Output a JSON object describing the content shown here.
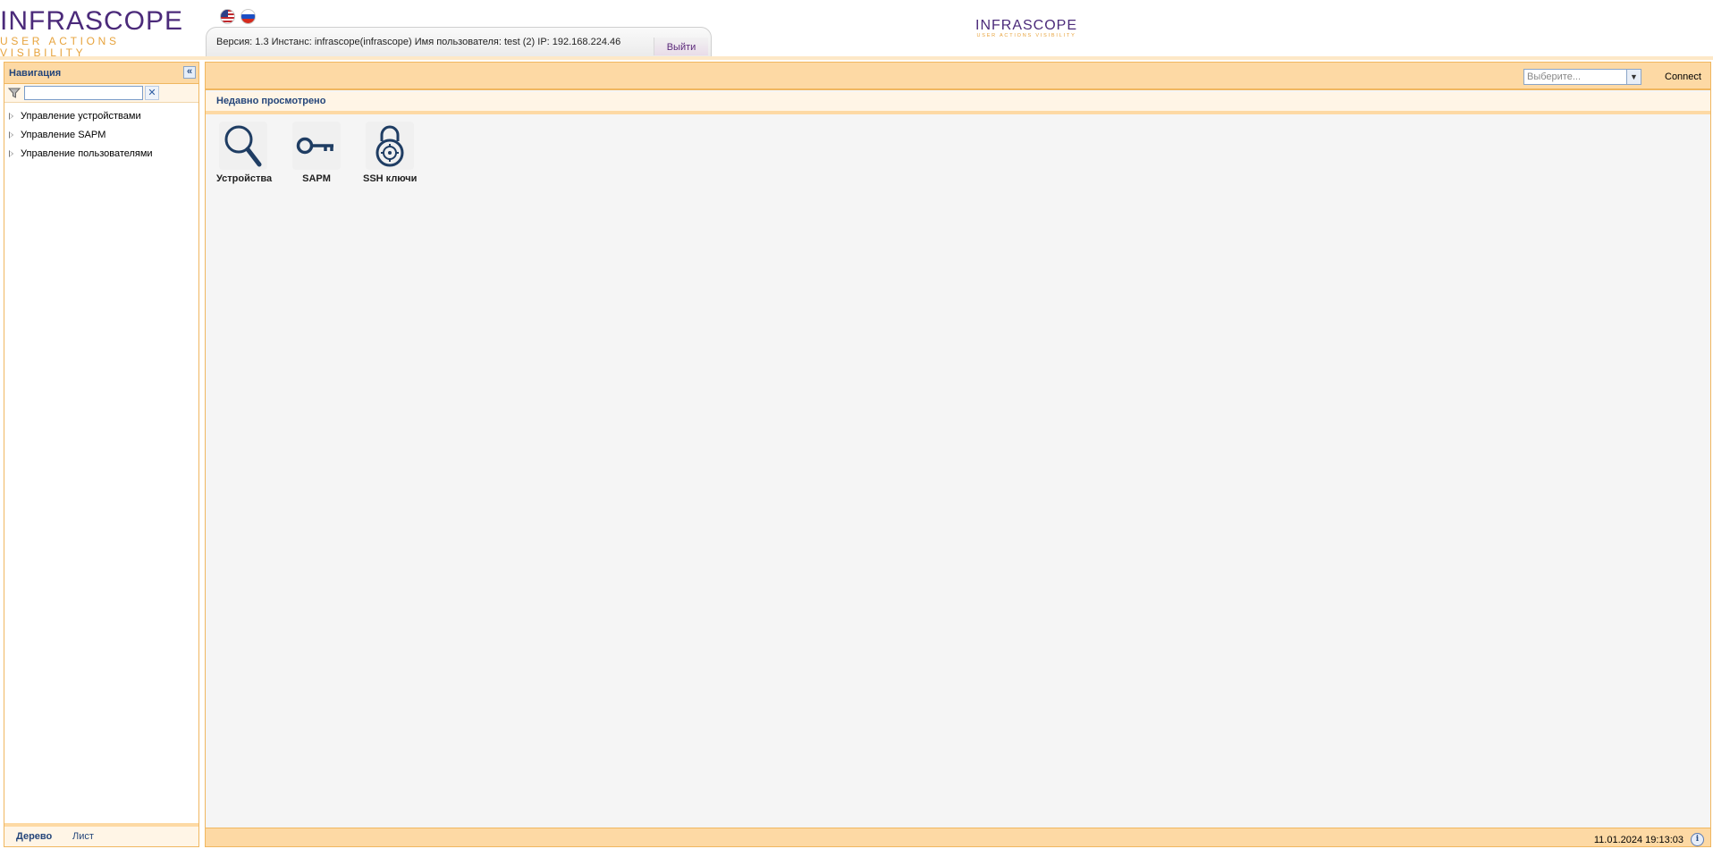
{
  "header": {
    "logo_title": "INFRASCOPE",
    "logo_subtitle": "USER ACTIONS VISIBILITY",
    "flags": [
      "us-flag-icon",
      "ru-flag-icon"
    ],
    "info_text": "Версия: 1.3 Инстанс: infrascope(infrascope) Имя пользователя: test (2) IP: 192.168.224.46",
    "logout_label": "Выйти",
    "center_logo_title": "INFRASCOPE",
    "center_logo_subtitle": "USER ACTIONS VISIBILITY"
  },
  "sidebar": {
    "title": "Навигация",
    "collapse_icon": "double-chevron-left-icon",
    "filter_placeholder": "",
    "clear_icon": "close-icon",
    "items": [
      {
        "label": "Управление устройствами"
      },
      {
        "label": "Управление SAPM"
      },
      {
        "label": "Управление пользователями"
      }
    ],
    "footer_tabs": {
      "tree": "Дерево",
      "list": "Лист"
    }
  },
  "main": {
    "select_placeholder": "Выберите...",
    "connect_label": "Connect",
    "section_title": "Недавно просмотрено",
    "tiles": [
      {
        "label": "Устройства",
        "icon": "magnifier-icon"
      },
      {
        "label": "SAPM",
        "icon": "key-icon"
      },
      {
        "label": "SSH ключи",
        "icon": "padlock-icon"
      }
    ],
    "status_time": "11.01.2024 19:13:03",
    "info_icon": "info-icon"
  },
  "colors": {
    "accent_purple": "#4b2a7a",
    "accent_orange": "#e7a33c",
    "panel_header": "#fdd9a4",
    "title_blue": "#24457a"
  }
}
